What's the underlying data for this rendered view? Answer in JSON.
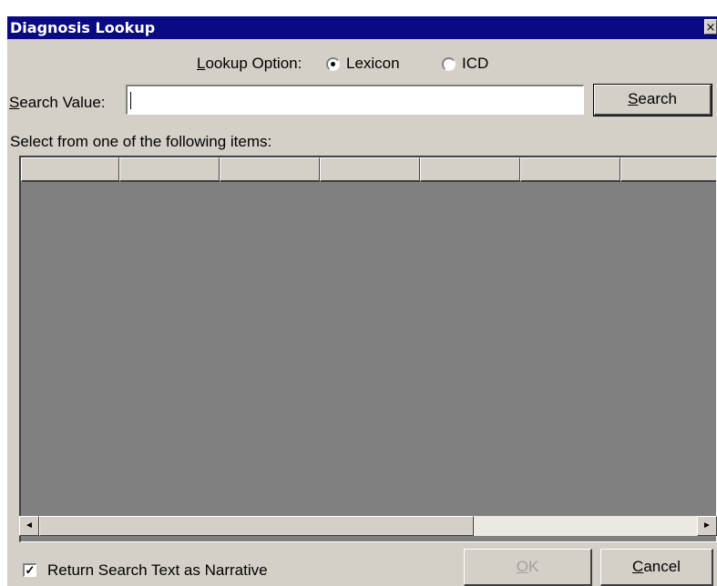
{
  "window": {
    "title": "Diagnosis Lookup",
    "close_glyph": "×"
  },
  "lookup_option": {
    "label_mnemonic": "L",
    "label_rest": "ookup Option:",
    "options": [
      {
        "label": "Lexicon",
        "checked": true
      },
      {
        "label": "ICD",
        "checked": false
      }
    ]
  },
  "search": {
    "label_mnemonic": "S",
    "label_rest": "earch Value:",
    "value": "",
    "button_mnemonic": "S",
    "button_rest": "earch"
  },
  "list": {
    "caption": "Select from one of the following items:",
    "column_count": 7,
    "columns": [
      "",
      "",
      "",
      "",
      "",
      "",
      ""
    ],
    "rows": []
  },
  "scrollbar": {
    "left_arrow": "◄",
    "right_arrow": "►"
  },
  "footer": {
    "checkbox_label": "Return Search Text as Narrative",
    "checkbox_checked": true,
    "checkbox_glyph": "✓",
    "ok_mnemonic": "O",
    "ok_rest": "K",
    "cancel_mnemonic": "C",
    "cancel_rest": "ancel"
  },
  "colors": {
    "title_bar": "#0a0a82",
    "dialog_face": "#d4d0c8",
    "list_background": "#808080"
  }
}
